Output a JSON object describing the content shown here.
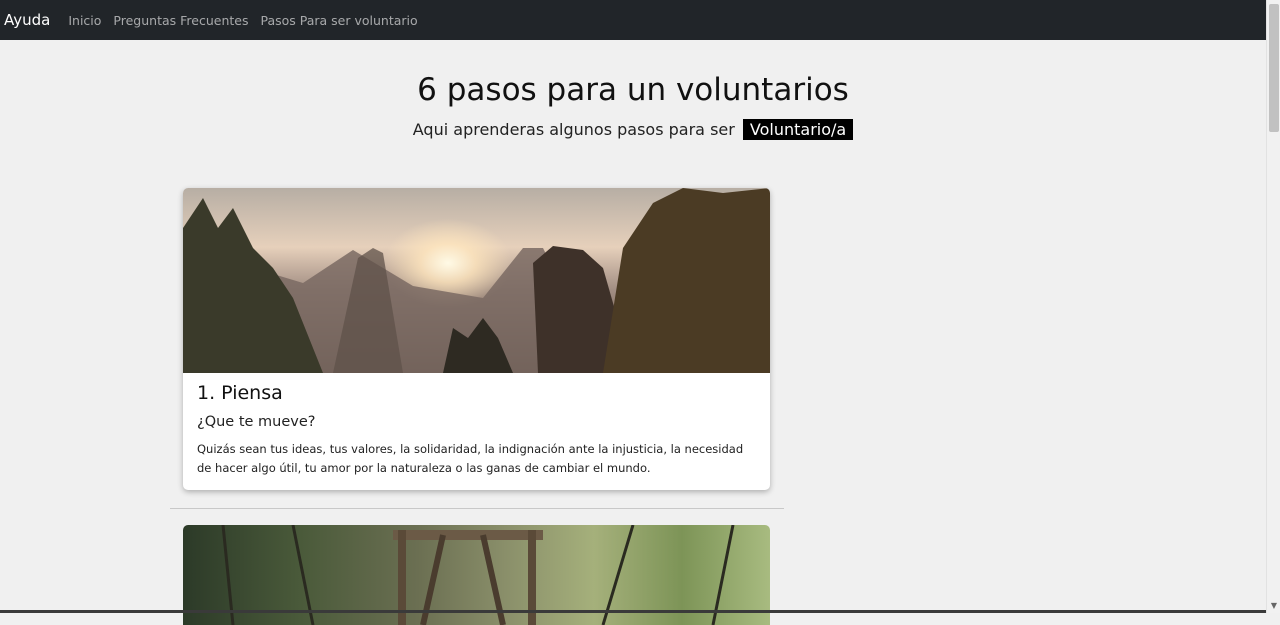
{
  "navbar": {
    "brand": "Ayuda",
    "links": [
      "Inicio",
      "Preguntas Frecuentes",
      "Pasos Para ser voluntario"
    ]
  },
  "header": {
    "title": "6 pasos para un voluntarios",
    "subtitle_text": "Aqui aprenderas algunos pasos para ser",
    "subtitle_highlight": "Voluntario/a"
  },
  "cards": [
    {
      "title": "1. Piensa",
      "subtitle": "¿Que te mueve?",
      "text": "Quizás sean tus ideas, tus valores, la solidaridad, la indignación ante la injusticia, la necesidad de hacer algo útil, tu amor por la naturaleza o las ganas de cambiar el mundo.",
      "image": "mountain-sunset-forest"
    },
    {
      "image": "forest-bridge"
    }
  ],
  "colors": {
    "navbar": "#212529",
    "background": "#f0f0f0",
    "highlight": "#000000"
  }
}
